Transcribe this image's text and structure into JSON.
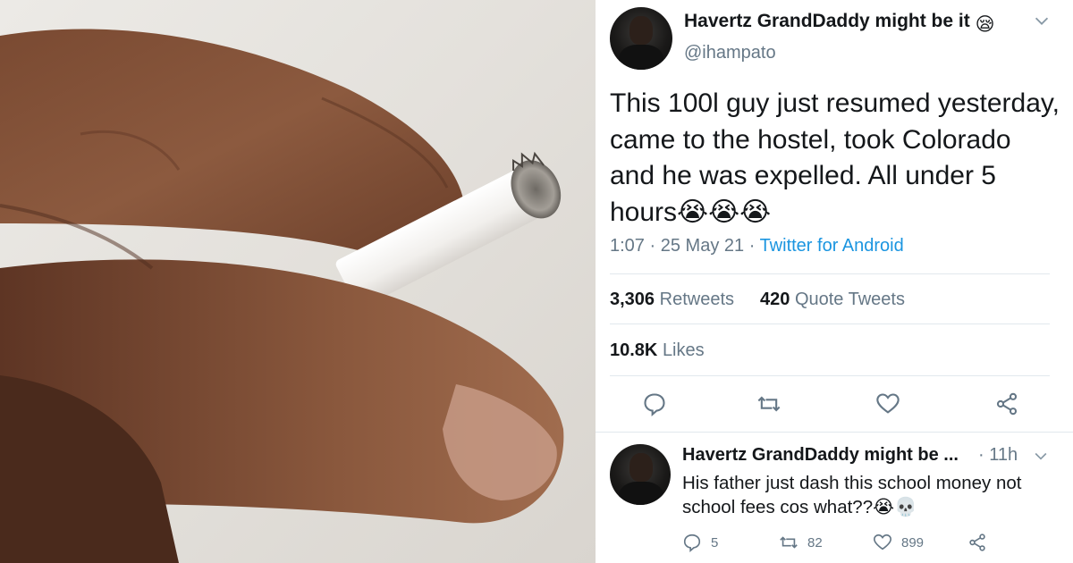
{
  "tweet": {
    "display_name": "Havertz GrandDaddy might be it",
    "name_emoji": "😪",
    "handle": "@ihampato",
    "text": "This 100l guy just resumed yesterday, came to the hostel, took Colorado and he was expelled. All under 5 hours",
    "text_emojis": "😭😭😭",
    "time": "1:07",
    "date": "25 May 21",
    "source": "Twitter for Android",
    "retweets_count": "3,306",
    "retweets_label": "Retweets",
    "quote_count": "420",
    "quote_label": "Quote Tweets",
    "likes_count": "10.8K",
    "likes_label": "Likes"
  },
  "icons": {
    "photo": "hand-holding-cigarette-photo",
    "more": "chevron-down-icon",
    "reply": "reply-icon",
    "retweet": "retweet-icon",
    "like": "heart-icon",
    "share": "share-icon"
  },
  "reply": {
    "display_name": "Havertz GrandDaddy might be ...",
    "time": "· 11h",
    "text": "His father just dash this school money not school fees cos what??",
    "text_emojis": "😭💀",
    "reply_count": "5",
    "retweet_count": "82",
    "like_count": "899"
  },
  "colors": {
    "text": "#14171a",
    "secondary": "#657786",
    "link": "#1b95e0",
    "divider": "#e1e8ed"
  }
}
